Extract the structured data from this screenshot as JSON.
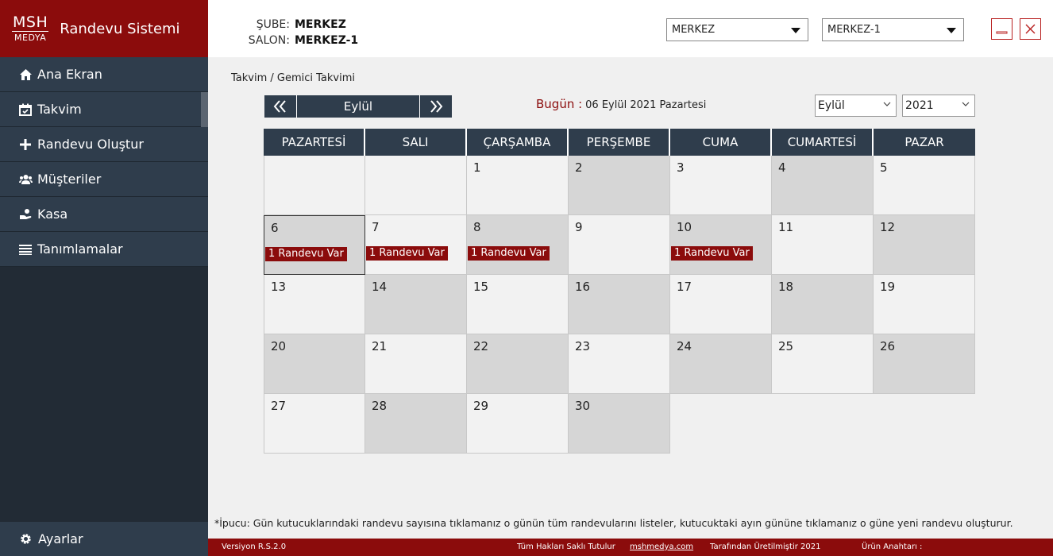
{
  "brand": {
    "logo_top": "MSH",
    "logo_bottom": "MEDYA",
    "title": "Randevu Sistemi"
  },
  "nav": [
    {
      "label": "Ana Ekran",
      "icon": "home-icon"
    },
    {
      "label": "Takvim",
      "icon": "calendar-icon"
    },
    {
      "label": "Randevu Oluştur",
      "icon": "plus-icon"
    },
    {
      "label": "Müşteriler",
      "icon": "users-icon"
    },
    {
      "label": "Kasa",
      "icon": "cash-icon"
    },
    {
      "label": "Tanımlamalar",
      "icon": "list-icon"
    }
  ],
  "settings": {
    "label": "Ayarlar",
    "icon": "gear-icon"
  },
  "header": {
    "branch_label": "ŞUBE:",
    "branch_value": "MERKEZ",
    "salon_label": "SALON:",
    "salon_value": "MERKEZ-1",
    "branch_select": "MERKEZ",
    "salon_select": "MERKEZ-1"
  },
  "breadcrumb": "Takvim / Gemici Takvimi",
  "month_nav": {
    "prev": "«",
    "label": "Eylül",
    "next": "»"
  },
  "today": {
    "label": "Bugün :",
    "date": "06 Eylül 2021 Pazartesi"
  },
  "filters": {
    "month": "Eylül",
    "year": "2021"
  },
  "calendar": {
    "weekdays": [
      "PAZARTESİ",
      "SALI",
      "ÇARŞAMBA",
      "PERŞEMBE",
      "CUMA",
      "CUMARTESİ",
      "PAZAR"
    ],
    "weeks": [
      [
        null,
        null,
        {
          "day": "1"
        },
        {
          "day": "2"
        },
        {
          "day": "3"
        },
        {
          "day": "4"
        },
        {
          "day": "5"
        }
      ],
      [
        {
          "day": "6",
          "badge": "1 Randevu Var",
          "selected": true
        },
        {
          "day": "7",
          "badge": "1 Randevu Var"
        },
        {
          "day": "8",
          "badge": "1 Randevu Var"
        },
        {
          "day": "9"
        },
        {
          "day": "10",
          "badge": "1 Randevu Var"
        },
        {
          "day": "11"
        },
        {
          "day": "12"
        }
      ],
      [
        {
          "day": "13"
        },
        {
          "day": "14"
        },
        {
          "day": "15"
        },
        {
          "day": "16"
        },
        {
          "day": "17"
        },
        {
          "day": "18"
        },
        {
          "day": "19"
        }
      ],
      [
        {
          "day": "20"
        },
        {
          "day": "21"
        },
        {
          "day": "22"
        },
        {
          "day": "23"
        },
        {
          "day": "24"
        },
        {
          "day": "25"
        },
        {
          "day": "26"
        }
      ],
      [
        {
          "day": "27"
        },
        {
          "day": "28"
        },
        {
          "day": "29"
        },
        {
          "day": "30"
        },
        null,
        null,
        null
      ]
    ]
  },
  "tip": "*İpucu: Gün kutucuklarındaki randevu sayısına tıklamanız o günün tüm randevularını listeler, kutucuktaki ayın gününe tıklamanız o güne yeni randevu oluşturur.",
  "footer": {
    "version": "Versiyon R.S.2.0",
    "rights": "Tüm Hakları Saklı Tutulur",
    "site": "mshmedya.com",
    "produced": "Tarafından Üretilmiştir  2021",
    "key": "Ürün Anahtarı :"
  },
  "colors": {
    "brand": "#8b0c0c",
    "sidebar": "#222b35",
    "nav": "#2f3d4c"
  }
}
